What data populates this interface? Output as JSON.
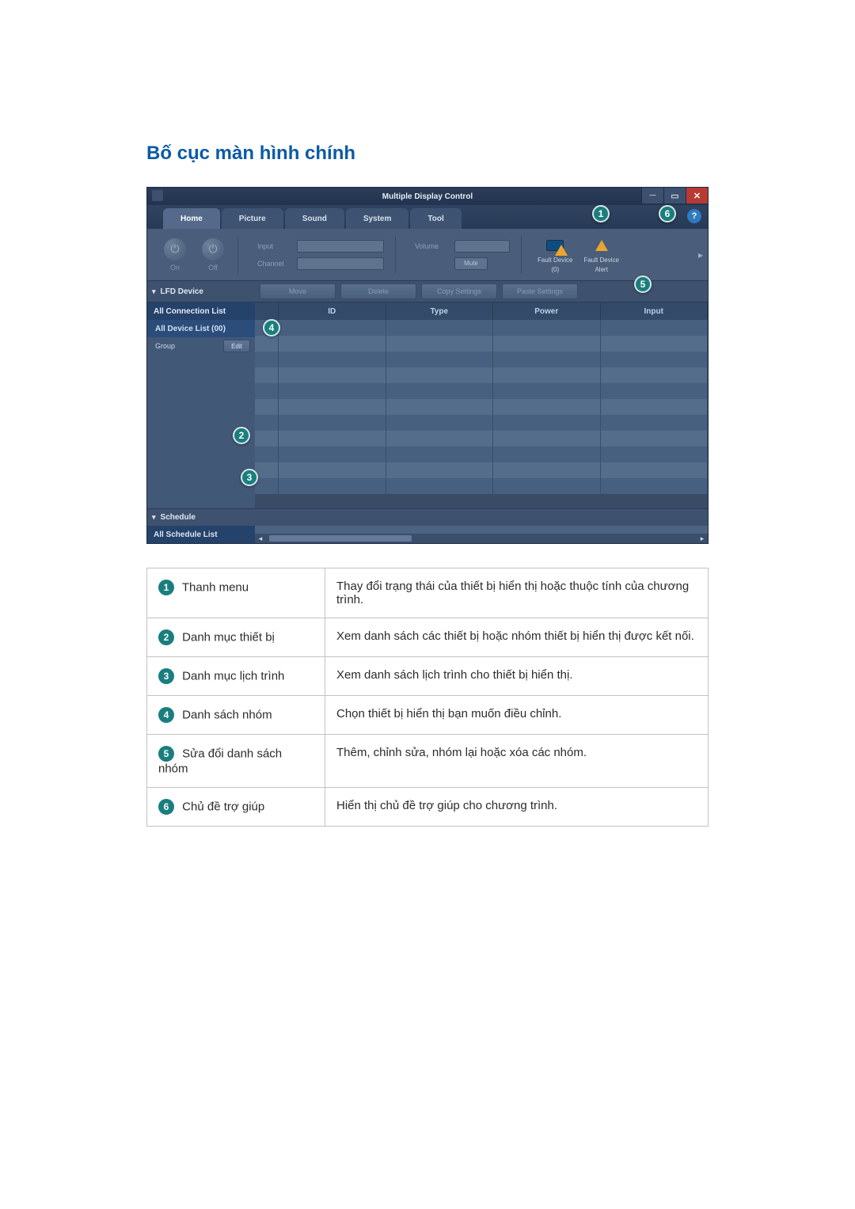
{
  "heading": "Bố cục màn hình chính",
  "app": {
    "title": "Multiple Display Control",
    "tabs": [
      "Home",
      "Picture",
      "Sound",
      "System",
      "Tool"
    ],
    "help_icon": "?",
    "toolbar": {
      "on": "On",
      "off": "Off",
      "input_label": "Input",
      "channel_label": "Channel",
      "volume_label": "Volume",
      "mute": "Mute",
      "fault1_line1": "Fault Device",
      "fault1_line2": "(0)",
      "fault2_line1": "Fault Device",
      "fault2_line2": "Alert"
    },
    "panel_left": "LFD Device",
    "actions": [
      "Move",
      "Delete",
      "Copy Settings",
      "Paste Settings"
    ],
    "side_head": "All Connection List",
    "side_item": "All Device List (00)",
    "group_label": "Group",
    "edit_btn": "Edit",
    "col_headers": [
      "ID",
      "Type",
      "Power",
      "Input"
    ],
    "schedule_label": "Schedule",
    "schedule_sub": "All Schedule List"
  },
  "callouts": {
    "c1": "1",
    "c2": "2",
    "c3": "3",
    "c4": "4",
    "c5": "5",
    "c6": "6"
  },
  "glossary": [
    {
      "num": "1",
      "label": "Thanh menu",
      "desc": "Thay đổi trạng thái của thiết bị hiển thị hoặc thuộc tính của chương trình."
    },
    {
      "num": "2",
      "label": "Danh mục thiết bị",
      "desc": "Xem danh sách các thiết bị hoặc nhóm thiết bị hiển thị được kết nối."
    },
    {
      "num": "3",
      "label": "Danh mục lịch trình",
      "desc": "Xem danh sách lịch trình cho thiết bị hiển thị."
    },
    {
      "num": "4",
      "label": "Danh sách nhóm",
      "desc": "Chọn thiết bị hiển thị bạn muốn điều chỉnh."
    },
    {
      "num": "5",
      "label": "Sửa đổi danh sách nhóm",
      "desc": "Thêm, chỉnh sửa, nhóm lại hoặc xóa các nhóm."
    },
    {
      "num": "6",
      "label": "Chủ đề trợ giúp",
      "desc": "Hiển thị chủ đề trợ giúp cho chương trình."
    }
  ]
}
